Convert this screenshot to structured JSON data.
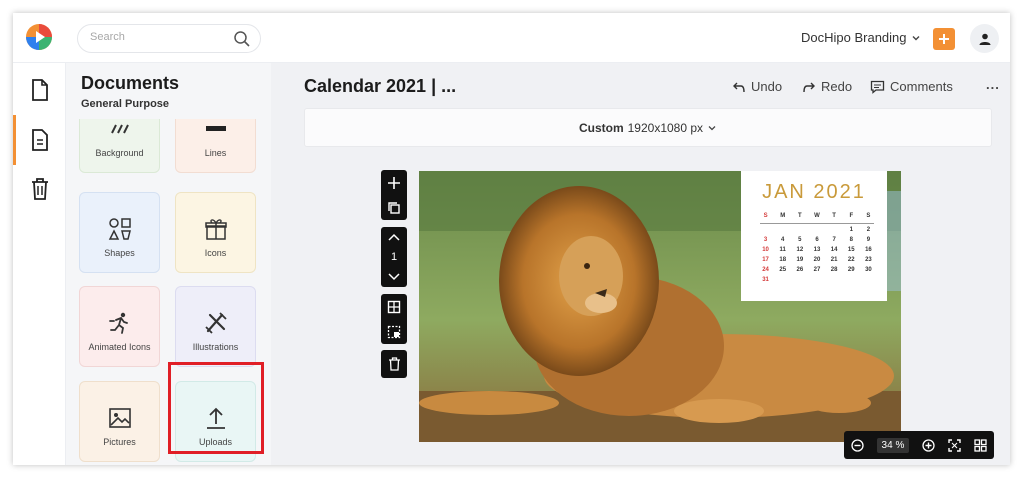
{
  "header": {
    "search_placeholder": "Search",
    "brand_label": "DocHipo Branding",
    "plus_label": "+"
  },
  "panel": {
    "title": "Documents",
    "subtitle": "General Purpose",
    "tiles": [
      {
        "label": "Background",
        "icon": "background-icon"
      },
      {
        "label": "Lines",
        "icon": "lines-icon"
      },
      {
        "label": "Shapes",
        "icon": "shapes-icon"
      },
      {
        "label": "Icons",
        "icon": "gift-icon"
      },
      {
        "label": "Animated Icons",
        "icon": "running-person-icon"
      },
      {
        "label": "Illustrations",
        "icon": "illustration-icon"
      },
      {
        "label": "Pictures",
        "icon": "picture-icon"
      },
      {
        "label": "Uploads",
        "icon": "upload-icon"
      }
    ]
  },
  "editor": {
    "doc_title": "Calendar 2021 | ...",
    "undo_label": "Undo",
    "redo_label": "Redo",
    "comments_label": "Comments",
    "more_label": "...",
    "size_name": "Custom",
    "size_value": "1920x1080 px",
    "page_number": "1",
    "zoom_value": "34",
    "zoom_unit": "%"
  },
  "calendar": {
    "title": "JAN 2021",
    "weekdays": [
      "S",
      "M",
      "T",
      "W",
      "T",
      "F",
      "S"
    ],
    "days": [
      "",
      "",
      "",
      "",
      "",
      "1",
      "2",
      "3",
      "4",
      "5",
      "6",
      "7",
      "8",
      "9",
      "10",
      "11",
      "12",
      "13",
      "14",
      "15",
      "16",
      "17",
      "18",
      "19",
      "20",
      "21",
      "22",
      "23",
      "24",
      "25",
      "26",
      "27",
      "28",
      "29",
      "30",
      "31",
      "",
      "",
      "",
      "",
      "",
      ""
    ]
  },
  "colors": {
    "accent": "#f39034",
    "highlight": "#e01e26",
    "calendar_gold": "#c99a3a",
    "sunday_red": "#d43a3a"
  }
}
